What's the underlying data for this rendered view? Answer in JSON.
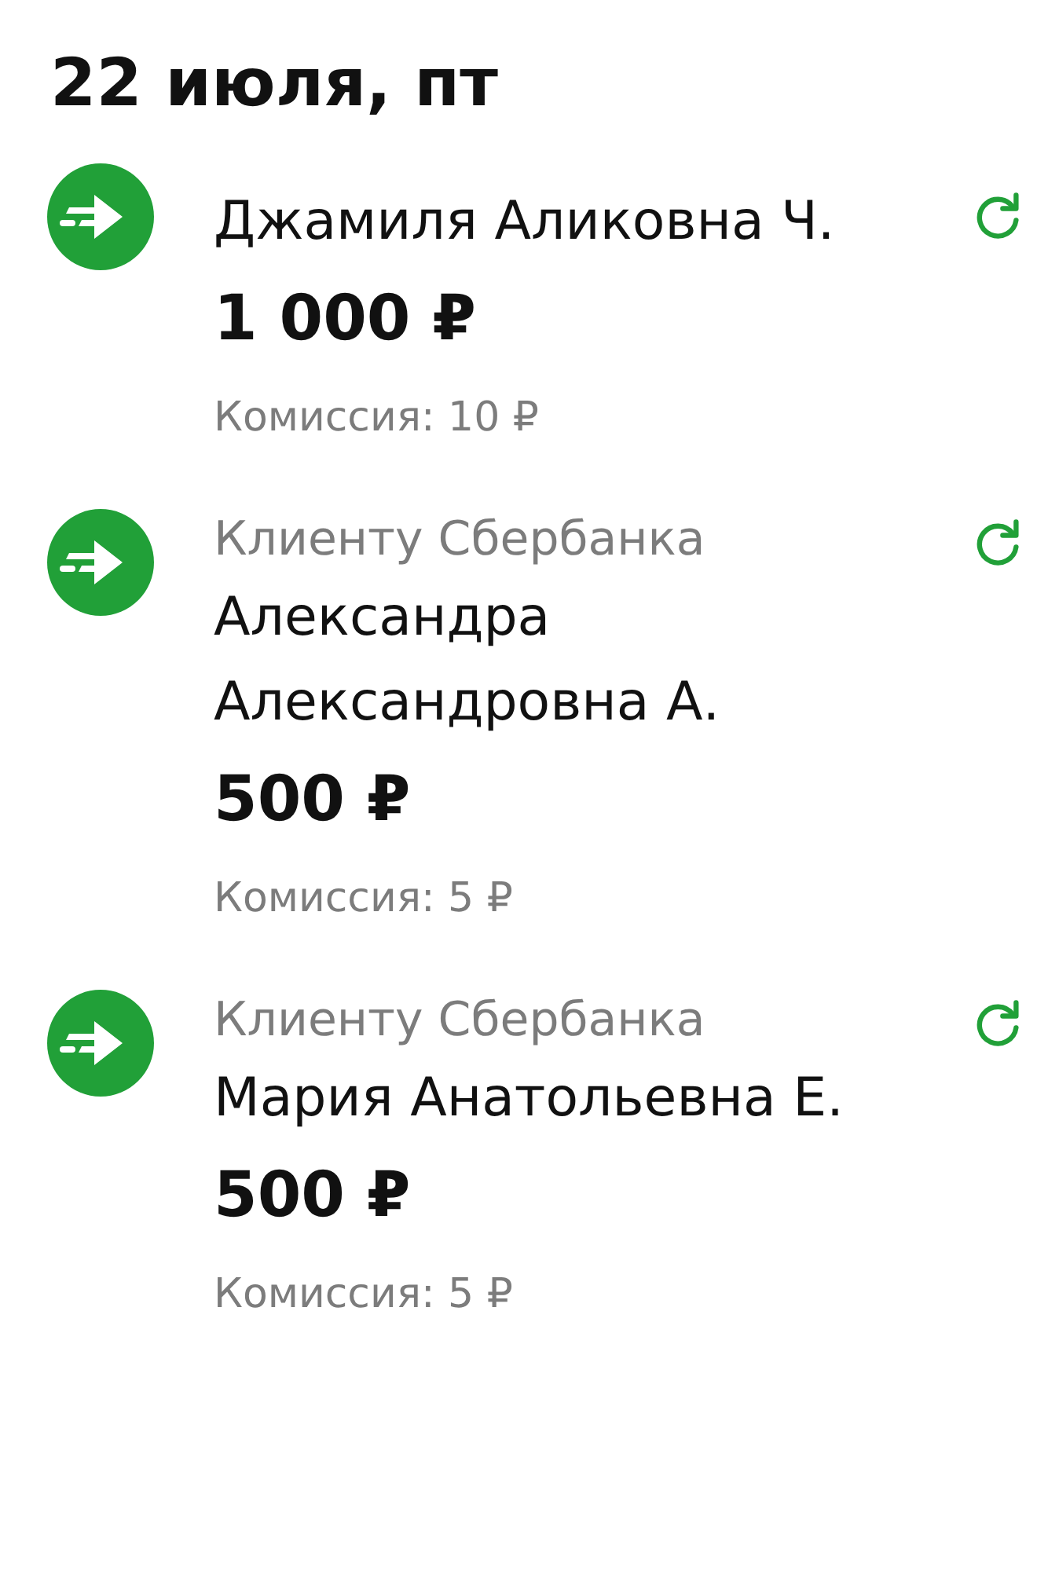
{
  "header": {
    "date": "22 июля, пт"
  },
  "transfers": [
    {
      "name": "Джамиля Аликовна Ч.",
      "amount": "1 000 ₽",
      "fee": "Комиссия: 10 ₽"
    },
    {
      "category": "Клиенту Сбербанка",
      "name": "Александра Александровна А.",
      "amount": "500 ₽",
      "fee": "Комиссия: 5 ₽"
    },
    {
      "category": "Клиенту Сбербанка",
      "name": "Мария Анатольевна Е.",
      "amount": "500 ₽",
      "fee": "Комиссия: 5 ₽"
    }
  ]
}
